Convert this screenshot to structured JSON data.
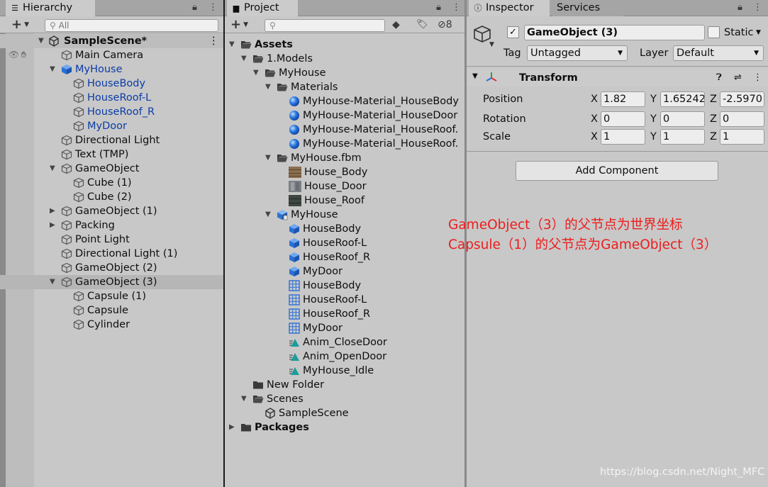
{
  "hierarchy": {
    "tab": "Hierarchy",
    "search_placeholder": "All",
    "scene": "SampleScene*",
    "rows": [
      {
        "label": "Main Camera",
        "depth": 0,
        "arrow": "",
        "icon": "gameobject",
        "color": "normal"
      },
      {
        "label": "MyHouse",
        "depth": 0,
        "arrow": "open",
        "icon": "prefab",
        "color": "blue"
      },
      {
        "label": "HouseBody",
        "depth": 1,
        "arrow": "",
        "icon": "gameobject",
        "color": "blue"
      },
      {
        "label": "HouseRoof-L",
        "depth": 1,
        "arrow": "",
        "icon": "gameobject",
        "color": "blue"
      },
      {
        "label": "HouseRoof_R",
        "depth": 1,
        "arrow": "",
        "icon": "gameobject",
        "color": "blue"
      },
      {
        "label": "MyDoor",
        "depth": 1,
        "arrow": "",
        "icon": "gameobject",
        "color": "blue"
      },
      {
        "label": "Directional Light",
        "depth": 0,
        "arrow": "",
        "icon": "gameobject",
        "color": "normal"
      },
      {
        "label": "Text (TMP)",
        "depth": 0,
        "arrow": "",
        "icon": "gameobject",
        "color": "normal"
      },
      {
        "label": "GameObject",
        "depth": 0,
        "arrow": "open",
        "icon": "gameobject",
        "color": "normal"
      },
      {
        "label": "Cube (1)",
        "depth": 1,
        "arrow": "",
        "icon": "gameobject",
        "color": "normal"
      },
      {
        "label": "Cube (2)",
        "depth": 1,
        "arrow": "",
        "icon": "gameobject",
        "color": "normal"
      },
      {
        "label": "GameObject (1)",
        "depth": 0,
        "arrow": "closed",
        "icon": "gameobject",
        "color": "normal"
      },
      {
        "label": "Packing",
        "depth": 0,
        "arrow": "closed",
        "icon": "gameobject",
        "color": "normal"
      },
      {
        "label": "Point Light",
        "depth": 0,
        "arrow": "",
        "icon": "gameobject",
        "color": "normal"
      },
      {
        "label": "Directional Light (1)",
        "depth": 0,
        "arrow": "",
        "icon": "gameobject",
        "color": "normal"
      },
      {
        "label": "GameObject (2)",
        "depth": 0,
        "arrow": "",
        "icon": "gameobject",
        "color": "normal"
      },
      {
        "label": "GameObject (3)",
        "depth": 0,
        "arrow": "open",
        "icon": "gameobject",
        "color": "normal",
        "selected": true
      },
      {
        "label": "Capsule (1)",
        "depth": 1,
        "arrow": "",
        "icon": "gameobject",
        "color": "normal"
      },
      {
        "label": "Capsule",
        "depth": 1,
        "arrow": "",
        "icon": "gameobject",
        "color": "normal"
      },
      {
        "label": "Cylinder",
        "depth": 1,
        "arrow": "",
        "icon": "gameobject",
        "color": "normal"
      }
    ]
  },
  "project": {
    "tab": "Project",
    "hidden_count": "8",
    "rows": [
      {
        "label": "Assets",
        "depth": 0,
        "arrow": "open",
        "icon": "folder-open",
        "bold": true
      },
      {
        "label": "1.Models",
        "depth": 1,
        "arrow": "open",
        "icon": "folder-open"
      },
      {
        "label": "MyHouse",
        "depth": 2,
        "arrow": "open",
        "icon": "folder-open"
      },
      {
        "label": "Materials",
        "depth": 3,
        "arrow": "open",
        "icon": "folder-open"
      },
      {
        "label": "MyHouse-Material_HouseBody",
        "depth": 4,
        "arrow": "",
        "icon": "material"
      },
      {
        "label": "MyHouse-Material_HouseDoor",
        "depth": 4,
        "arrow": "",
        "icon": "material"
      },
      {
        "label": "MyHouse-Material_HouseRoof.",
        "depth": 4,
        "arrow": "",
        "icon": "material"
      },
      {
        "label": "MyHouse-Material_HouseRoof.",
        "depth": 4,
        "arrow": "",
        "icon": "material"
      },
      {
        "label": "MyHouse.fbm",
        "depth": 3,
        "arrow": "open",
        "icon": "folder-open"
      },
      {
        "label": "House_Body",
        "depth": 4,
        "arrow": "",
        "icon": "texture-body"
      },
      {
        "label": "House_Door",
        "depth": 4,
        "arrow": "",
        "icon": "texture-door"
      },
      {
        "label": "House_Roof",
        "depth": 4,
        "arrow": "",
        "icon": "texture-roof"
      },
      {
        "label": "MyHouse",
        "depth": 3,
        "arrow": "open",
        "icon": "model"
      },
      {
        "label": "HouseBody",
        "depth": 4,
        "arrow": "",
        "icon": "prefab"
      },
      {
        "label": "HouseRoof-L",
        "depth": 4,
        "arrow": "",
        "icon": "prefab"
      },
      {
        "label": "HouseRoof_R",
        "depth": 4,
        "arrow": "",
        "icon": "prefab"
      },
      {
        "label": "MyDoor",
        "depth": 4,
        "arrow": "",
        "icon": "prefab"
      },
      {
        "label": "HouseBody",
        "depth": 4,
        "arrow": "",
        "icon": "mesh"
      },
      {
        "label": "HouseRoof-L",
        "depth": 4,
        "arrow": "",
        "icon": "mesh"
      },
      {
        "label": "HouseRoof_R",
        "depth": 4,
        "arrow": "",
        "icon": "mesh"
      },
      {
        "label": "MyDoor",
        "depth": 4,
        "arrow": "",
        "icon": "mesh"
      },
      {
        "label": "Anim_CloseDoor",
        "depth": 4,
        "arrow": "",
        "icon": "anim"
      },
      {
        "label": "Anim_OpenDoor",
        "depth": 4,
        "arrow": "",
        "icon": "anim"
      },
      {
        "label": "MyHouse_Idle",
        "depth": 4,
        "arrow": "",
        "icon": "anim"
      },
      {
        "label": "New Folder",
        "depth": 1,
        "arrow": "",
        "icon": "folder"
      },
      {
        "label": "Scenes",
        "depth": 1,
        "arrow": "open",
        "icon": "folder-open"
      },
      {
        "label": "SampleScene",
        "depth": 2,
        "arrow": "",
        "icon": "unity"
      },
      {
        "label": "Packages",
        "depth": 0,
        "arrow": "closed",
        "icon": "folder",
        "bold": true
      }
    ]
  },
  "inspector": {
    "tab": "Inspector",
    "tab2": "Services",
    "name": "GameObject (3)",
    "static_label": "Static",
    "tag_label": "Tag",
    "tag_value": "Untagged",
    "layer_label": "Layer",
    "layer_value": "Default",
    "component": "Transform",
    "position_label": "Position",
    "rotation_label": "Rotation",
    "scale_label": "Scale",
    "pos": {
      "x": "1.82",
      "y": "1.65242",
      "z": "-2.5970"
    },
    "rot": {
      "x": "0",
      "y": "0",
      "z": "0"
    },
    "scale": {
      "x": "1",
      "y": "1",
      "z": "1"
    },
    "add_component": "Add Component"
  },
  "annotation": {
    "line1": "GameObject（3）的父节点为世界坐标",
    "line2": "Capsule（1）的父节点为GameObject（3）"
  },
  "watermark": "https://blog.csdn.net/Night_MFC",
  "colors": {
    "blue_text": "#0b3ca8",
    "annotation": "#ee1c1c",
    "panel": "#c8c8c8",
    "selected": "#b6b6b6"
  }
}
